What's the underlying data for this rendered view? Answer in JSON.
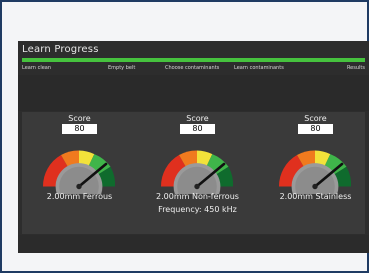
{
  "window": {
    "title": "Learn Progress"
  },
  "steps": [
    "Learn clean",
    "Empty belt",
    "Choose contaminants",
    "Learn contaminants",
    "Results"
  ],
  "gauges": [
    {
      "score_label": "Score",
      "score": "80",
      "caption": "2.00mm Ferrous",
      "subcaption": ""
    },
    {
      "score_label": "Score",
      "score": "80",
      "caption": "2.00mm Non-ferrous",
      "subcaption": "Frequency: 450 kHz"
    },
    {
      "score_label": "Score",
      "score": "80",
      "caption": "2.00mm Stainless",
      "subcaption": ""
    }
  ],
  "colors": {
    "progress": "#46c23e",
    "gauge_red": "#e0301e",
    "gauge_orange": "#f07a1e",
    "gauge_yellow": "#f2e23a",
    "gauge_green": "#3fb54a",
    "gauge_dark_green": "#0f6b2d"
  }
}
